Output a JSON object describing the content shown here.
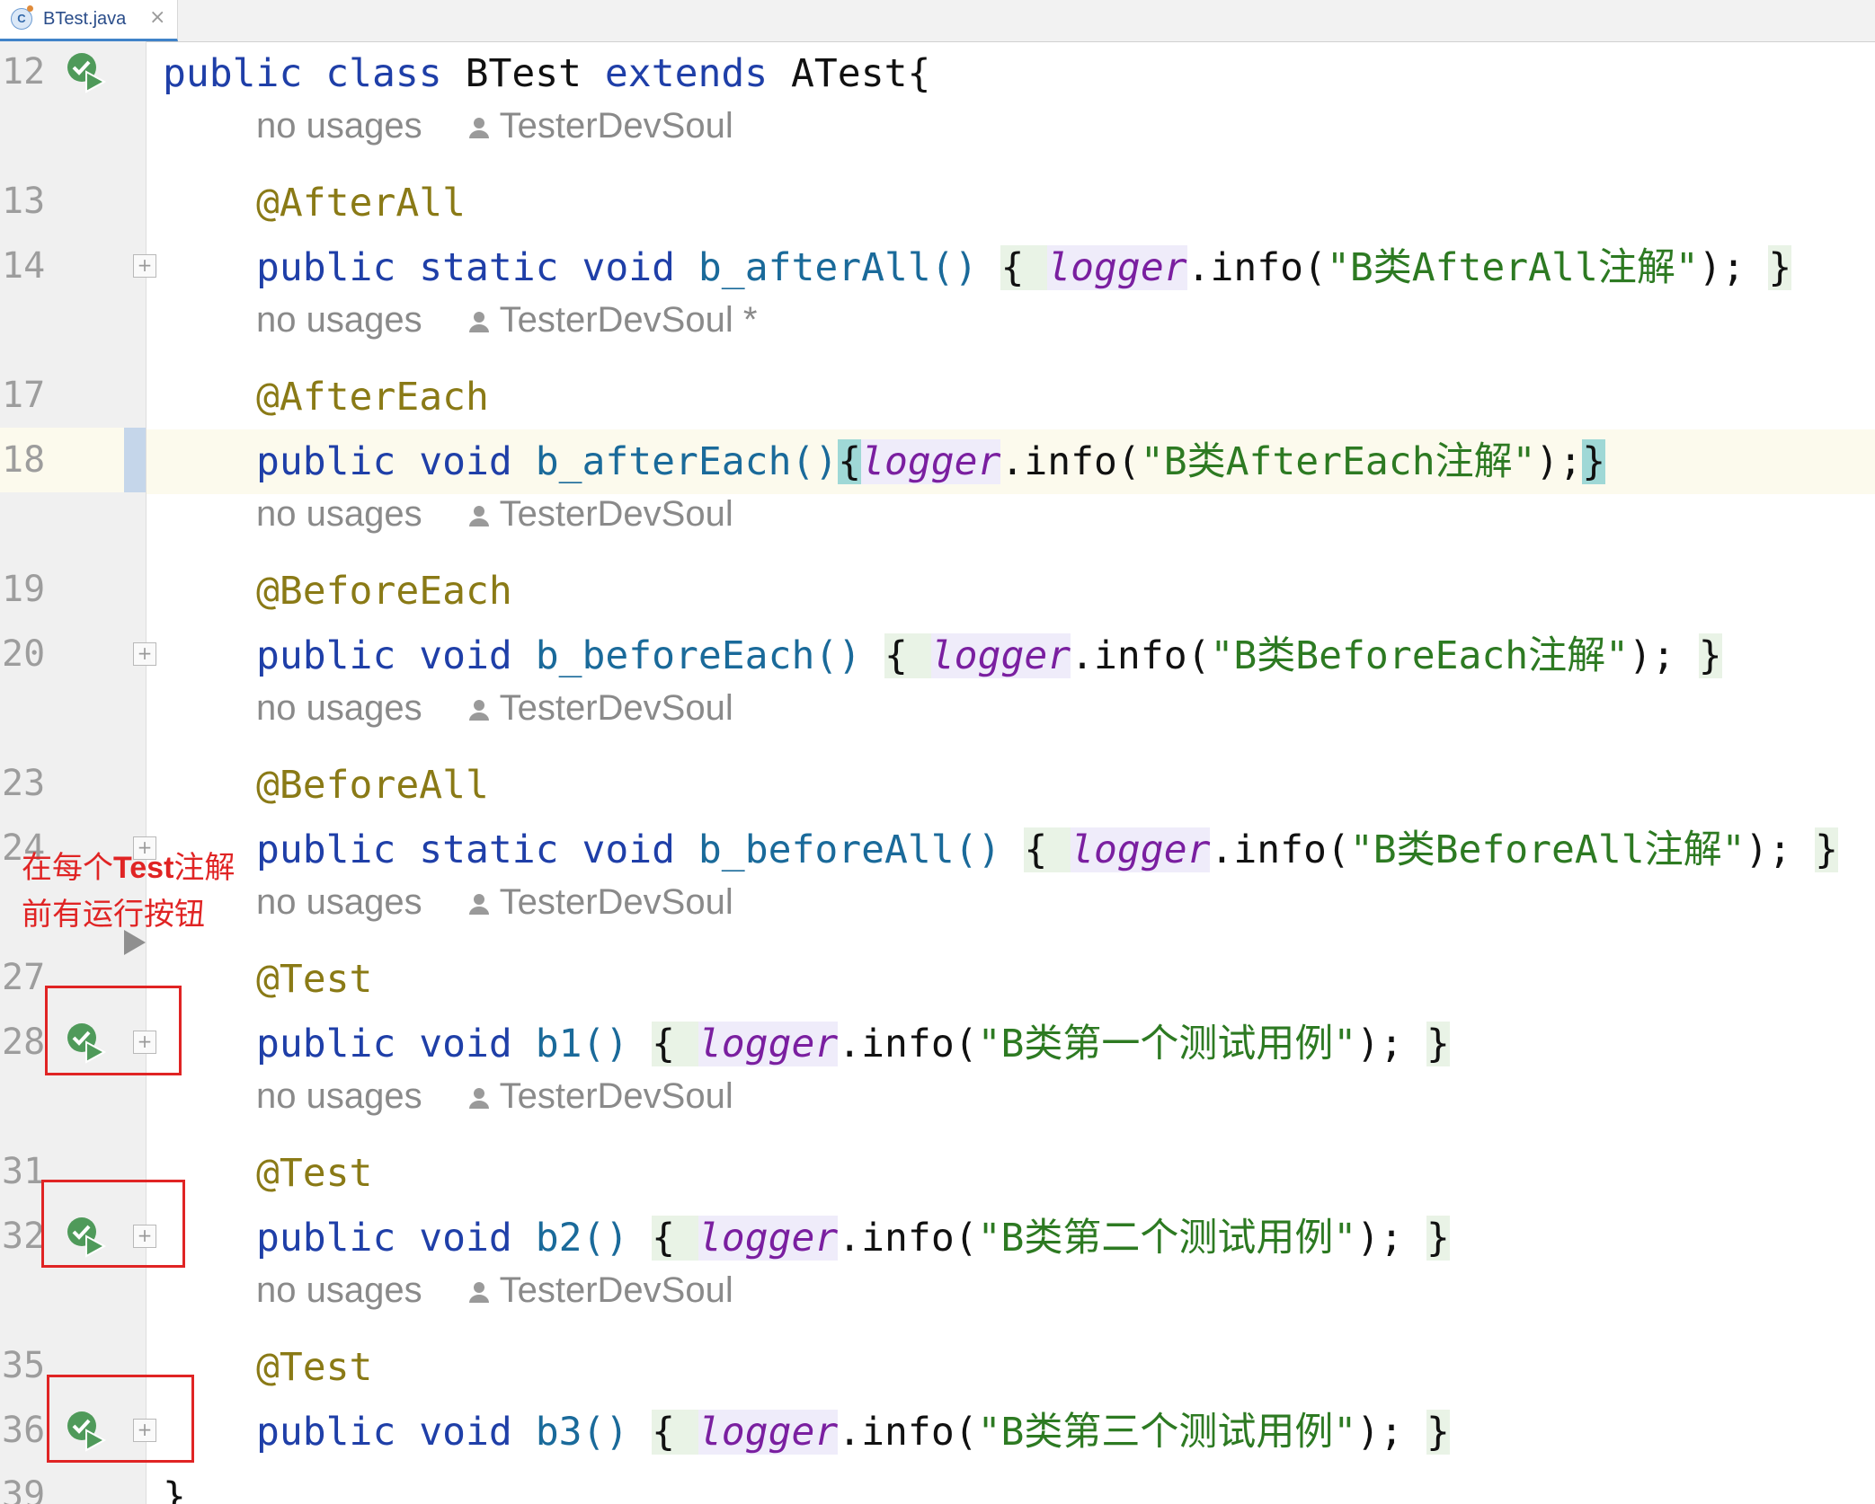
{
  "tab": {
    "icon": "java-class-icon",
    "icon_letter": "C",
    "title": "BTest.java",
    "close": "×"
  },
  "hints": {
    "usages": "no usages",
    "author": "TesterDevSoul",
    "author_modified": "TesterDevSoul *"
  },
  "lines": {
    "l12": "12",
    "l13": "13",
    "l14": "14",
    "l17": "17",
    "l18": "18",
    "l19": "19",
    "l20": "20",
    "l23": "23",
    "l24": "24",
    "l27": "27",
    "l28": "28",
    "l31": "31",
    "l32": "32",
    "l35": "35",
    "l36": "36",
    "l39": "39"
  },
  "code": {
    "public": "public",
    "class": "class",
    "static": "static",
    "void": "void",
    "extends": "extends",
    "class_name": "BTest",
    "parent": "ATest{",
    "after_all": "@AfterAll",
    "after_each": "@AfterEach",
    "before_each": "@BeforeEach",
    "before_all": "@BeforeAll",
    "test": "@Test",
    "m_after_all": "b_afterAll()",
    "m_after_each": "b_afterEach()",
    "m_before_each": "b_beforeEach()",
    "m_before_all": "b_beforeAll()",
    "m_b1": "b1()",
    "m_b2": "b2()",
    "m_b3": "b3()",
    "open_brace": "{",
    "close_brace": "}",
    "logger": "logger",
    "info_open": ".info(",
    "info_close": ");",
    "s_after_all": "\"B类AfterAll注解\"",
    "s_after_each": "\"B类AfterEach注解\"",
    "s_before_each": "\"B类BeforeEach注解\"",
    "s_before_all": "\"B类BeforeAll注解\"",
    "s_b1": "\"B类第一个测试用例\"",
    "s_b2": "\"B类第二个测试用例\"",
    "s_b3": "\"B类第三个测试用例\"",
    "closing": "}"
  },
  "annotation_note": {
    "line1_a": "在每个",
    "line1_b": "Test",
    "line1_c": "注解",
    "line2": "前有运行按钮"
  },
  "colors": {
    "keyword": "#1f3fa8",
    "annotation": "#8a7a16",
    "string": "#2d7a22",
    "field": "#7a1fa0",
    "note": "#e02424"
  }
}
